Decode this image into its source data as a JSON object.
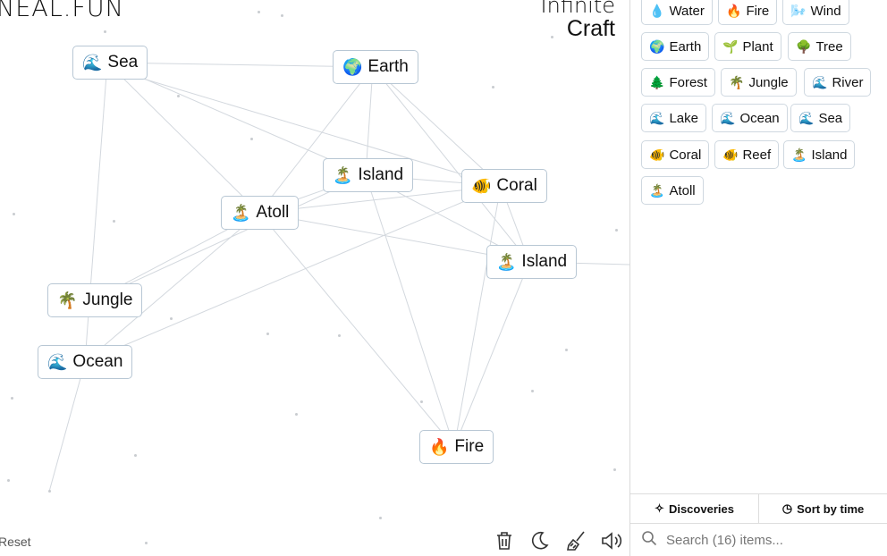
{
  "logo": "NEAL.FUN",
  "title": {
    "line1": "Infinite",
    "line2": "Craft"
  },
  "canvas_nodes": [
    {
      "name": "node-sea",
      "emoji": "🌊",
      "label": "Sea"
    },
    {
      "name": "node-earth",
      "emoji": "🌍",
      "label": "Earth"
    },
    {
      "name": "node-island-1",
      "emoji": "🏝️",
      "label": "Island"
    },
    {
      "name": "node-coral",
      "emoji": "🐠",
      "label": "Coral"
    },
    {
      "name": "node-atoll",
      "emoji": "🏝️",
      "label": "Atoll"
    },
    {
      "name": "node-island-2",
      "emoji": "🏝️",
      "label": "Island"
    },
    {
      "name": "node-jungle",
      "emoji": "🌴",
      "label": "Jungle"
    },
    {
      "name": "node-ocean",
      "emoji": "🌊",
      "label": "Ocean"
    },
    {
      "name": "node-fire",
      "emoji": "🔥",
      "label": "Fire"
    }
  ],
  "reset_label": "Reset",
  "toolbar": {
    "icons": [
      "trash-icon",
      "moon-icon",
      "broom-icon",
      "sound-icon"
    ]
  },
  "sidebar": {
    "items": [
      {
        "emoji": "💧",
        "label": "Water"
      },
      {
        "emoji": "🔥",
        "label": "Fire"
      },
      {
        "emoji": "🌬️",
        "label": "Wind"
      },
      {
        "emoji": "🌍",
        "label": "Earth"
      },
      {
        "emoji": "🌱",
        "label": "Plant"
      },
      {
        "emoji": "🌳",
        "label": "Tree"
      },
      {
        "emoji": "🌲",
        "label": "Forest"
      },
      {
        "emoji": "🌴",
        "label": "Jungle"
      },
      {
        "emoji": "🌊",
        "label": "River"
      },
      {
        "emoji": "🌊",
        "label": "Lake"
      },
      {
        "emoji": "🌊",
        "label": "Ocean"
      },
      {
        "emoji": "🌊",
        "label": "Sea"
      },
      {
        "emoji": "🐠",
        "label": "Coral"
      },
      {
        "emoji": "🐠",
        "label": "Reef"
      },
      {
        "emoji": "🏝️",
        "label": "Island"
      },
      {
        "emoji": "🏝️",
        "label": "Atoll"
      }
    ],
    "tabs": [
      {
        "icon": "sparkle-icon",
        "label": "Discoveries"
      },
      {
        "icon": "clock-icon",
        "label": "Sort by time"
      }
    ],
    "search": {
      "placeholder": "Search (16) items..."
    }
  }
}
